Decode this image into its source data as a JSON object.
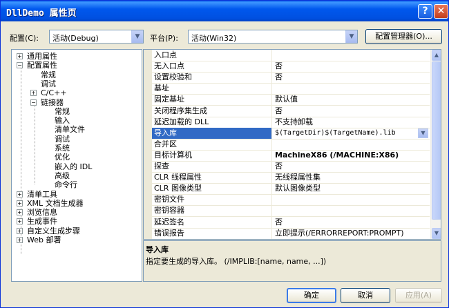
{
  "window": {
    "title": "DllDemo 属性页",
    "help_glyph": "?",
    "close_glyph": "✕"
  },
  "toolbar": {
    "config_label": "配置(C):",
    "config_value": "活动(Debug)",
    "platform_label": "平台(P):",
    "platform_value": "活动(Win32)",
    "config_manager_label": "配置管理器(O)..."
  },
  "tree": {
    "collapsed_glyph": "+",
    "expanded_glyph": "−",
    "items": [
      {
        "label": "通用属性",
        "state": "collapsed"
      },
      {
        "label": "配置属性",
        "state": "expanded"
      },
      {
        "label": "常规",
        "state": "leaf"
      },
      {
        "label": "调试",
        "state": "leaf"
      },
      {
        "label": "C/C++",
        "state": "collapsed"
      },
      {
        "label": "链接器",
        "state": "expanded"
      },
      {
        "label": "常规",
        "state": "leaf"
      },
      {
        "label": "输入",
        "state": "leaf"
      },
      {
        "label": "清单文件",
        "state": "leaf"
      },
      {
        "label": "调试",
        "state": "leaf"
      },
      {
        "label": "系统",
        "state": "leaf"
      },
      {
        "label": "优化",
        "state": "leaf"
      },
      {
        "label": "嵌入的 IDL",
        "state": "leaf"
      },
      {
        "label": "高级",
        "state": "leaf"
      },
      {
        "label": "命令行",
        "state": "leaf"
      },
      {
        "label": "清单工具",
        "state": "collapsed"
      },
      {
        "label": "XML 文档生成器",
        "state": "collapsed"
      },
      {
        "label": "浏览信息",
        "state": "collapsed"
      },
      {
        "label": "生成事件",
        "state": "collapsed"
      },
      {
        "label": "自定义生成步骤",
        "state": "collapsed"
      },
      {
        "label": "Web 部署",
        "state": "collapsed"
      }
    ]
  },
  "properties": [
    {
      "name": "入口点",
      "value": ""
    },
    {
      "name": "无入口点",
      "value": "否"
    },
    {
      "name": "设置校验和",
      "value": "否"
    },
    {
      "name": "基址",
      "value": ""
    },
    {
      "name": "固定基址",
      "value": "默认值"
    },
    {
      "name": "关闭程序集生成",
      "value": "否"
    },
    {
      "name": "延迟加载的 DLL",
      "value": "不支持卸载"
    },
    {
      "name": "导入库",
      "value": "$(TargetDir)$(TargetName).lib",
      "selected": true
    },
    {
      "name": "合并区",
      "value": ""
    },
    {
      "name": "目标计算机",
      "value": "MachineX86 (/MACHINE:X86)",
      "bold": true
    },
    {
      "name": "探查",
      "value": "否"
    },
    {
      "name": "CLR 线程属性",
      "value": "无线程属性集"
    },
    {
      "name": "CLR 图像类型",
      "value": "默认图像类型"
    },
    {
      "name": "密钥文件",
      "value": ""
    },
    {
      "name": "密钥容器",
      "value": ""
    },
    {
      "name": "延迟签名",
      "value": "否"
    },
    {
      "name": "错误报告",
      "value": "立即提示(/ERRORREPORT:PROMPT)"
    }
  ],
  "description": {
    "title": "导入库",
    "text": "指定要生成的导入库。   (/IMPLIB:[name, name, ...])"
  },
  "buttons": {
    "ok": "确定",
    "cancel": "取消",
    "apply": "应用(A)"
  },
  "glyphs": {
    "down": "▼",
    "up": "▲"
  },
  "colors": {
    "selection": "#316ac5",
    "titlebar": "#0058ee",
    "face": "#ece9d8"
  }
}
